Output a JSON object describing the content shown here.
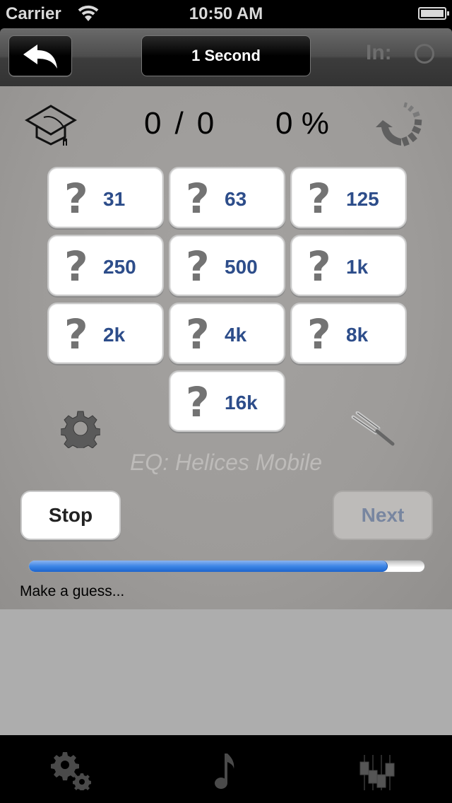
{
  "status_bar": {
    "carrier": "Carrier",
    "time": "10:50 AM",
    "wifi_icon": "wifi-icon",
    "battery_icon": "battery-icon"
  },
  "nav_bar": {
    "back_icon": "reply-arrow-icon",
    "title": "1 Second",
    "input_label": "In:",
    "input_indicator_icon": "circle-indicator-icon"
  },
  "score": {
    "correct": "0",
    "separator": "/",
    "total": "0",
    "percent": "0 %",
    "left_icon": "graduation-cap-icon",
    "right_icon": "reset-arrow-icon"
  },
  "frequency_buttons": [
    {
      "label": "31",
      "icon": "question-mark-icon"
    },
    {
      "label": "63",
      "icon": "question-mark-icon"
    },
    {
      "label": "125",
      "icon": "question-mark-icon"
    },
    {
      "label": "250",
      "icon": "question-mark-icon"
    },
    {
      "label": "500",
      "icon": "question-mark-icon"
    },
    {
      "label": "1k",
      "icon": "question-mark-icon"
    },
    {
      "label": "2k",
      "icon": "question-mark-icon"
    },
    {
      "label": "4k",
      "icon": "question-mark-icon"
    },
    {
      "label": "8k",
      "icon": "question-mark-icon"
    },
    {
      "label": "16k",
      "icon": "question-mark-icon"
    }
  ],
  "question_glyph": "?",
  "eq_label": "EQ: Helices Mobile",
  "controls": {
    "stop_label": "Stop",
    "next_label": "Next",
    "next_enabled": false
  },
  "progress": {
    "fraction": 0.907
  },
  "status_message": "Make a guess...",
  "colors": {
    "frequency_label": "#2d4d8a",
    "progress_fill": "#3d86e6",
    "next_disabled_text": "#7886a0"
  },
  "tab_bar": [
    {
      "name": "settings",
      "icon": "gears-icon"
    },
    {
      "name": "music",
      "icon": "music-note-icon"
    },
    {
      "name": "equalizer",
      "icon": "equalizer-sliders-icon"
    }
  ]
}
